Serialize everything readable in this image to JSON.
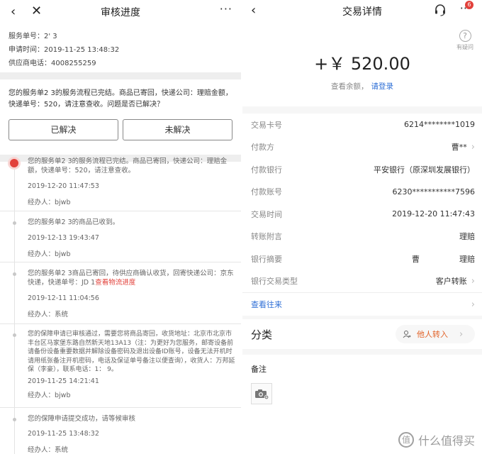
{
  "left": {
    "nav": {
      "back_icon": "back-icon",
      "close_icon": "close-icon",
      "title": "审核进度",
      "more": "···"
    },
    "info": {
      "service_no": "服务单号：2'                3",
      "apply_time": "申请时间：2019-11-25 13:48:32",
      "supplier_phone": "供应商电话：4008255259"
    },
    "notice": {
      "text": "您的服务单2              3的服务流程已完结。商品已寄回，快递公司：理赔金额，快递单号：520，请注意查收。问题是否已解决？",
      "resolved": "已解决",
      "unresolved": "未解决"
    },
    "timeline": [
      {
        "msg": "您的服务单2              3的服务流程已完结。商品已寄回，快递公司：理赔金额，快递单号：520，请注意查收。",
        "link": "",
        "time": "2019-12-20 11:47:53",
        "handler": "经办人：bjwb"
      },
      {
        "msg": "您的服务单2              3的商品已收到。",
        "link": "",
        "time": "2019-12-13 19:43:47",
        "handler": "经办人：bjwb"
      },
      {
        "msg": "您的服务单2              3商品已寄回，待供应商确认收货，回寄快递公司：京东快递，快递单号：JD                                1",
        "link": "查看物流进度",
        "time": "2019-12-11 11:04:56",
        "handler": "经办人：系统"
      },
      {
        "msg": "您的保障申请已审核通过，需要您将商品寄回，收货地址：北京市北京市丰台区马家堡东路自然新天地13A13（注：为更好为您服务，邮寄设备前请备份设备重要数据并解除设备密码及退出设备ID账号，设备无法开机时请用纸张备注开机密码，电话及保证单号备注以便查询），收货人：万邦延保（李豪），联系电话：1：                    9。",
        "link": "",
        "time": "2019-11-25 14:21:41",
        "handler": "经办人：bjwb"
      },
      {
        "msg": "您的保障申请提交成功，请等候审核",
        "link": "",
        "time": "2019-11-25 13:48:32",
        "handler": "经办人：系统"
      }
    ]
  },
  "right": {
    "nav": {
      "back_icon": "back-icon",
      "title": "交易详情",
      "headset_icon": "headset-icon",
      "more": "···",
      "badge": "6"
    },
    "help": {
      "icon": "?",
      "label": "有疑问"
    },
    "amount": "+￥ 520.00",
    "balance": {
      "text": "查看余额，",
      "login": "请登录"
    },
    "details": [
      {
        "key": "交易卡号",
        "value": "6214********1019",
        "chevron": false
      },
      {
        "key": "付款方",
        "value": "曹**",
        "chevron": true
      },
      {
        "key": "付款银行",
        "value": "平安银行（原深圳发展银行）",
        "chevron": false
      },
      {
        "key": "付款账号",
        "value": "6230***********7596",
        "chevron": false
      },
      {
        "key": "交易时间",
        "value": "2019-12-20 11:47:43",
        "chevron": false
      },
      {
        "key": "转账附言",
        "value": "理赔",
        "chevron": false
      },
      {
        "key": "银行摘要",
        "value": "曹                理赔",
        "chevron": false
      },
      {
        "key": "银行交易类型",
        "value": "客户转账",
        "chevron": true
      }
    ],
    "view_more": "查看往来",
    "category": {
      "label": "分类",
      "tag": "他人转入"
    },
    "remark": {
      "label": "备注"
    },
    "watermark": {
      "logo": "值",
      "text": "什么值得买"
    }
  }
}
